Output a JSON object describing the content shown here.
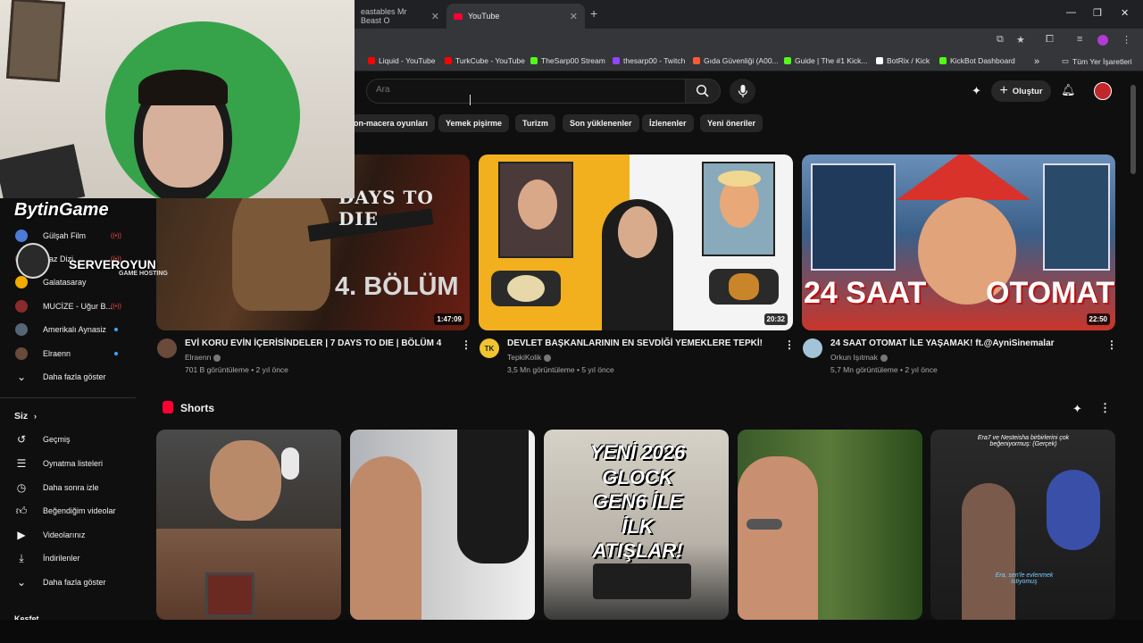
{
  "browser": {
    "tabs": [
      {
        "label": "eastables Mr Beast O",
        "active": false
      },
      {
        "label": "YouTube",
        "active": true
      }
    ],
    "bookmarks": [
      {
        "label": "Liquid - YouTube",
        "color": "#ff0000"
      },
      {
        "label": "TurkCube - YouTube",
        "color": "#ff0000"
      },
      {
        "label": "TheSarp00 Stream",
        "color": "#53fc18"
      },
      {
        "label": "thesarp00 - Twitch",
        "color": "#9146ff"
      },
      {
        "label": "Gıda Güvenliği (A00...",
        "color": "#ff5a36"
      },
      {
        "label": "Guide | The #1 Kick...",
        "color": "#53fc18"
      },
      {
        "label": "BotRix / Kick",
        "color": "#ffffff"
      },
      {
        "label": "KickBot Dashboard",
        "color": "#53fc18"
      }
    ],
    "all_bookmarks": "Tüm Yer İşaretleri"
  },
  "header": {
    "search_placeholder": "Ara",
    "create_label": "Oluştur"
  },
  "chips": [
    "on-macera oyunları",
    "Yemek pişirme",
    "Turizm",
    "Son yüklenenler",
    "İzlenenler",
    "Yeni öneriler"
  ],
  "overlay": {
    "brand1": "BytinGame",
    "brand2": "SERVEROYUN",
    "brand2_sub": "GAME HOSTING"
  },
  "sidebar": {
    "subscriptions": [
      {
        "label": "Gülşah Film",
        "status": "live",
        "color": "#4a7bd6"
      },
      {
        "label": "Gaz Dizi",
        "status": "live",
        "color": "#7a4a2a"
      },
      {
        "label": "Galatasaray",
        "status": "none",
        "color": "#f2a900"
      },
      {
        "label": "MUCİZE - Uğur B...",
        "status": "live",
        "color": "#8a2a2a"
      },
      {
        "label": "Amerikalı Aynasiz",
        "status": "new",
        "color": "#556677"
      },
      {
        "label": "Elraenn",
        "status": "new",
        "color": "#6a4a3a"
      }
    ],
    "show_more": "Daha fazla göster",
    "you_heading": "Siz",
    "you_items": [
      {
        "label": "Geçmiş",
        "icon": "history-icon"
      },
      {
        "label": "Oynatma listeleri",
        "icon": "playlist-icon"
      },
      {
        "label": "Daha sonra izle",
        "icon": "clock-icon"
      },
      {
        "label": "Beğendiğim videolar",
        "icon": "thumbs-up-icon"
      },
      {
        "label": "Videolarınız",
        "icon": "your-videos-icon"
      },
      {
        "label": "İndirilenler",
        "icon": "download-icon"
      }
    ],
    "show_more_2": "Daha fazla göster",
    "explore_heading": "Keşfet"
  },
  "videos": [
    {
      "title": "EVİ KORU EVİN İÇERİSİNDELER | 7 DAYS TO DIE | BÖLÜM 4",
      "channel": "Elraenn",
      "views": "701 B görüntüleme",
      "age": "2 yıl önce",
      "duration": "1:47:09",
      "thumb_text_1": "DAYS TO DIE",
      "thumb_text_2": "4. BÖLÜM"
    },
    {
      "title": "DEVLET BAŞKANLARININ EN SEVDİĞİ YEMEKLERE TEPKİ!",
      "channel": "TepkiKolik",
      "views": "3,5 Mn görüntüleme",
      "age": "5 yıl önce",
      "duration": "20:32",
      "avatar_text": "TK"
    },
    {
      "title": "24 SAAT OTOMAT İLE YAŞAMAK! ft.@AyniSinemalar",
      "channel": "Orkun Işıtmak",
      "views": "5,7 Mn görüntüleme",
      "age": "2 yıl önce",
      "duration": "22:50",
      "thumb_text_1": "24 SAAT",
      "thumb_text_2": "OTOMAT"
    }
  ],
  "shorts": {
    "heading": "Shorts",
    "items": [
      {
        "overlay_text": ""
      },
      {
        "overlay_text": ""
      },
      {
        "overlay_text": "YENİ 2026 GLOCK GEN6 İLE İLK ATIŞLAR!"
      },
      {
        "overlay_text": ""
      },
      {
        "overlay_text": "Era7 ve Nesteisha birbirlerini çok beğeniyormuş: (Gerçek)",
        "overlay_text_2": "Era, sen'le evlenmek istiyomuş"
      }
    ]
  }
}
